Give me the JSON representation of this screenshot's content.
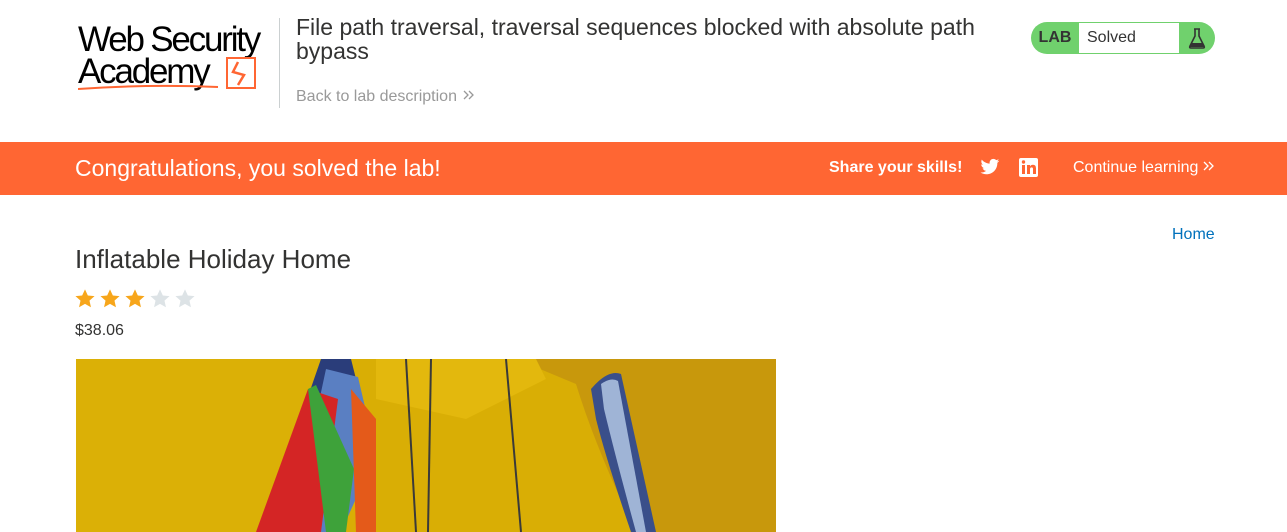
{
  "header": {
    "logo_line1": "Web Security",
    "logo_line2": "Academy",
    "lab_title": "File path traversal, traversal sequences blocked with absolute path bypass",
    "back_link": "Back to lab description",
    "lab_badge": "LAB",
    "lab_state": "Solved"
  },
  "banner": {
    "message": "Congratulations, you solved the lab!",
    "share": "Share your skills!",
    "continue": "Continue learning",
    "icons": [
      "twitter-icon",
      "linkedin-icon",
      "chevron-right-icon"
    ]
  },
  "nav": {
    "home": "Home"
  },
  "product": {
    "title": "Inflatable Holiday Home",
    "rating": 3,
    "rating_max": 5,
    "price": "$38.06"
  },
  "colors": {
    "accent_orange": "#ff6633",
    "lab_green": "#70d16d",
    "link_blue": "#0071bc",
    "star_gold": "#f7a61b",
    "star_empty": "#dde3e6"
  }
}
